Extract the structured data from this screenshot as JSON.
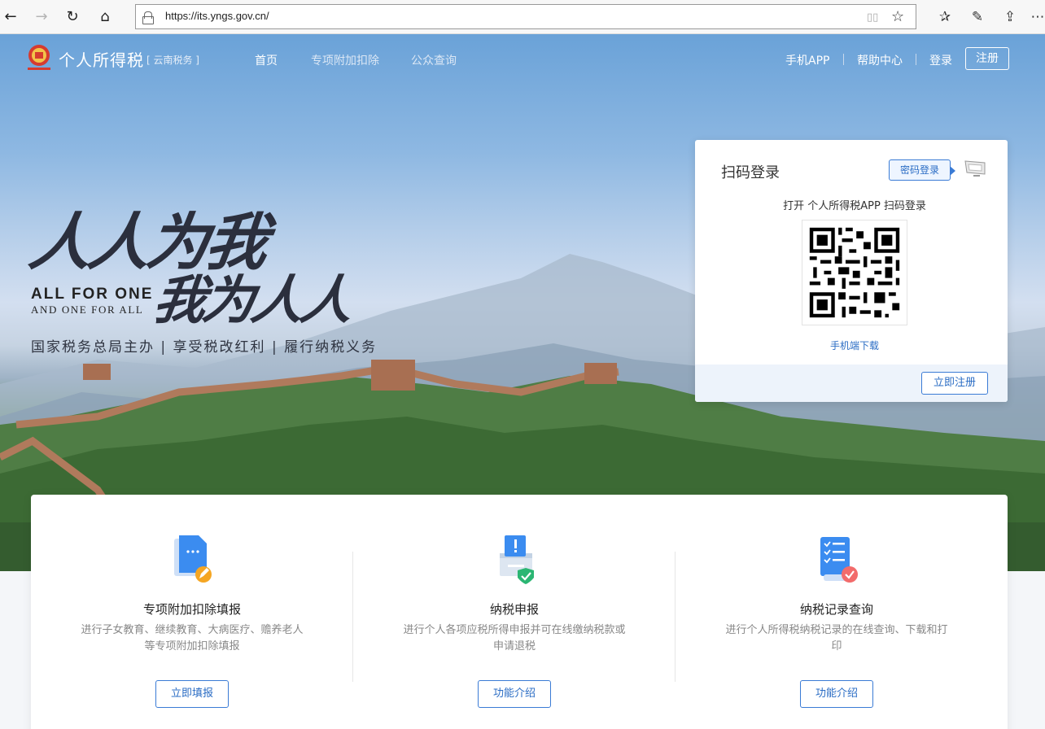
{
  "browser": {
    "url": "https://its.yngs.gov.cn/"
  },
  "site": {
    "name": "个人所得税",
    "region": "[ 云南税务 ]",
    "nav": [
      "首页",
      "专项附加扣除",
      "公众查询"
    ],
    "right_nav": [
      "手机APP",
      "帮助中心",
      "登录"
    ],
    "register": "注册"
  },
  "slogan": {
    "cn_line1": "人人为我",
    "cn_line2": "我为人人",
    "en_line1": "ALL FOR ONE",
    "en_line2": "AND ONE FOR ALL",
    "subtitle": "国家税务总局主办 | 享受税改红利 | 履行纳税义务"
  },
  "login": {
    "title": "扫码登录",
    "password_login": "密码登录",
    "scan_hint": "打开 个人所得税APP 扫码登录",
    "download": "手机端下载",
    "register_now": "立即注册"
  },
  "services": [
    {
      "title": "专项附加扣除填报",
      "desc": "进行子女教育、继续教育、大病医疗、赡养老人等专项附加扣除填报",
      "button": "立即填报",
      "icon": "document-edit-icon"
    },
    {
      "title": "纳税申报",
      "desc": "进行个人各项应税所得申报并可在线缴纳税款或申请退税",
      "button": "功能介绍",
      "icon": "tax-box-icon"
    },
    {
      "title": "纳税记录查询",
      "desc": "进行个人所得税纳税记录的在线查询、下载和打印",
      "button": "功能介绍",
      "icon": "record-list-icon"
    }
  ],
  "colors": {
    "accent": "#2a6cc4",
    "slogan": "#2b2f3d"
  }
}
